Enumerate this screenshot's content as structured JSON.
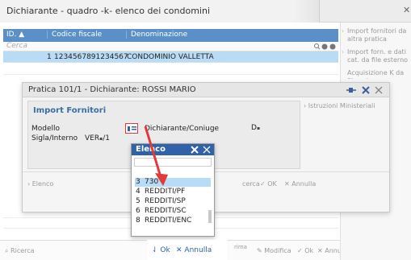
{
  "main_window": {
    "title": "Dichiarante - quadro -k-  elenco dei condomini",
    "close": "✕",
    "grid": {
      "columns": [
        "ID. ▲",
        "Codice fiscale",
        "Denominazione"
      ],
      "search_placeholder": "Cerca",
      "rows": [
        {
          "id": "1",
          "codice_fiscale": "1234567891234567",
          "denominazione": "CONDOMINIO VALLETTA"
        }
      ]
    },
    "right_panel": [
      {
        "label": "Import fornitori da altra pratica"
      },
      {
        "label": "Import forn. e dati cat. da file esterno"
      },
      {
        "label": "Acquisizione K da file esterno"
      }
    ],
    "bottom_buttons": [
      {
        "label": "Ricerca",
        "icon": "search-icon"
      },
      {
        "label": "Modifica",
        "icon": "pencil-icon"
      },
      {
        "label": "Ok",
        "icon": "check-icon"
      },
      {
        "label": "Annulla",
        "icon": "close-icon"
      }
    ],
    "bottom_fragment": "rima"
  },
  "pratica_dialog": {
    "title": "Pratica 101/1 - Dichiarante: ROSSI MARIO",
    "section_title": "Import Fornitori",
    "fields": {
      "modello_label": "Modello",
      "dichiarante_label": "Dichiarante/Coniuge",
      "dichiarante_value": "D",
      "sigla_label": "Sigla/Interno",
      "sigla_value": "VER",
      "sigla_suffix": "/1"
    },
    "side_button": "Istruzioni Ministeriali",
    "footer_buttons": [
      {
        "label": "Elenco"
      },
      {
        "label": "cerca"
      },
      {
        "label": "OK",
        "icon": "check-icon"
      },
      {
        "label": "Annulla",
        "icon": "close-icon"
      }
    ]
  },
  "elenco_popup": {
    "title": "Elenco",
    "input_value": "",
    "items": [
      {
        "code": "3",
        "label": "730",
        "selected": true
      },
      {
        "code": "4",
        "label": "REDDITI/PF",
        "selected": false
      },
      {
        "code": "5",
        "label": "REDDITI/SP",
        "selected": false
      },
      {
        "code": "6",
        "label": "REDDITI/SC",
        "selected": false
      },
      {
        "code": "8",
        "label": "REDDITI/ENC",
        "selected": false
      }
    ],
    "footer_buttons": [
      {
        "label": "Ok",
        "icon": "select-icon"
      },
      {
        "label": "Annulla",
        "icon": "close-icon"
      }
    ]
  },
  "colors": {
    "grid_header": "#5a8fc8",
    "selected_row": "#b8dcf5",
    "popup_title": "#2f62a8",
    "accent_text": "#3a6ea5",
    "annotation_arrow": "#e03a3a"
  }
}
